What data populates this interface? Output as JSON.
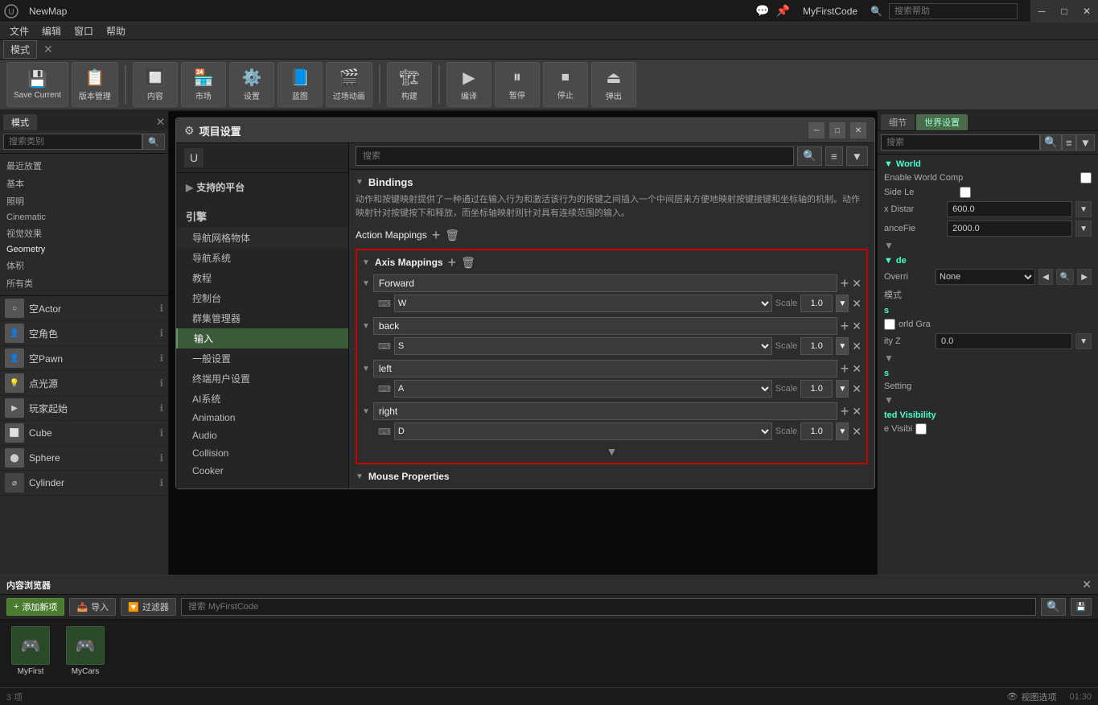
{
  "titleBar": {
    "title": "NewMap",
    "appName": "MyFirstCode",
    "minimizeLabel": "─",
    "maximizeLabel": "□",
    "closeLabel": "✕"
  },
  "menuBar": {
    "items": [
      "文件",
      "编辑",
      "窗口",
      "帮助"
    ]
  },
  "modeBar": {
    "label": "模式",
    "searchPlaceholder": "搜索类别"
  },
  "toolbar": {
    "buttons": [
      {
        "id": "save",
        "label": "Save Current",
        "icon": "💾"
      },
      {
        "id": "version",
        "label": "版本管理",
        "icon": "📋"
      },
      {
        "id": "content",
        "label": "内容",
        "icon": "🔲"
      },
      {
        "id": "market",
        "label": "市场",
        "icon": "🏪"
      },
      {
        "id": "settings",
        "label": "设置",
        "icon": "⚙️"
      },
      {
        "id": "blueprint",
        "label": "蓝图",
        "icon": "🎬"
      },
      {
        "id": "cinematic",
        "label": "过场动画",
        "icon": "🎥"
      },
      {
        "id": "build",
        "label": "构建",
        "icon": "🔨"
      },
      {
        "id": "play",
        "label": "编译",
        "icon": "▶"
      },
      {
        "id": "pause",
        "label": "暂停",
        "icon": "⏸"
      },
      {
        "id": "stop",
        "label": "停止",
        "icon": "⏹"
      },
      {
        "id": "eject",
        "label": "弹出",
        "icon": "⏏"
      }
    ]
  },
  "leftPanel": {
    "searchPlaceholder": "搜索类别",
    "categories": [
      {
        "label": "最近放置",
        "active": false
      },
      {
        "label": "基本",
        "active": false
      },
      {
        "label": "照明",
        "active": false
      },
      {
        "label": "Cinematic",
        "active": false
      },
      {
        "label": "视觉效果",
        "active": false
      },
      {
        "label": "Geometry",
        "active": true
      },
      {
        "label": "体积",
        "active": false
      },
      {
        "label": "所有类",
        "active": false
      }
    ],
    "actors": [
      {
        "label": "空Actor",
        "icon": "○"
      },
      {
        "label": "空角色",
        "icon": "👤"
      },
      {
        "label": "空Pawn",
        "icon": "👤"
      },
      {
        "label": "点光源",
        "icon": "💡"
      },
      {
        "label": "玩家起始",
        "icon": "▶"
      },
      {
        "label": "Cube",
        "icon": "⬜"
      },
      {
        "label": "Sphere",
        "icon": "⬤"
      },
      {
        "label": "Cylinder",
        "icon": "⌀"
      }
    ]
  },
  "viewport": {
    "background": "#0a0a0a"
  },
  "rightPanel": {
    "detailLabel": "细节",
    "worldSettingsLabel": "世界设置",
    "searchPlaceholder": "搜索",
    "sections": {
      "world": {
        "title": "World",
        "enableWorldComposition": {
          "label": "Enable World Comp",
          "checked": false
        },
        "sideLengthLabel": "Side Le",
        "sideLength": "",
        "xDistanceLabel": "x Distar",
        "xDistance": "600.0",
        "lancefieldLabel": "anceFie",
        "lancefield": "2000.0"
      },
      "lod": {
        "title": "de",
        "overrideLabel": "Overri",
        "overrideValue": "None",
        "modeLabel": "模式"
      },
      "gravity": {
        "title": "s",
        "worldGravityLabel": "orld Gra",
        "gravityZLabel": "ity Z",
        "gravityZ": "0.0"
      },
      "settings": {
        "title": "s",
        "settingLabel": "Setting"
      },
      "visibility": {
        "title": "ted Visibility",
        "visibleLabel": "e Visibi"
      }
    }
  },
  "dialog": {
    "title": "项目设置",
    "platformsLabel": "支持的平台",
    "engineLabel": "引擎",
    "sidebarItems": [
      {
        "label": "导航网格物体",
        "active": false
      },
      {
        "label": "导航系统",
        "active": false
      },
      {
        "label": "教程",
        "active": false
      },
      {
        "label": "控制台",
        "active": false
      },
      {
        "label": "群集管理器",
        "active": false
      },
      {
        "label": "输入",
        "active": true
      },
      {
        "label": "一般设置",
        "active": false
      },
      {
        "label": "终端用户设置",
        "active": false
      },
      {
        "label": "AI系统",
        "active": false
      },
      {
        "label": "Animation",
        "active": false
      },
      {
        "label": "Audio",
        "active": false
      },
      {
        "label": "Collision",
        "active": false
      },
      {
        "label": "Cooker",
        "active": false
      }
    ],
    "searchPlaceholder": "搜索",
    "contentHeader": "",
    "bindingsSection": {
      "title": "Bindings",
      "description": "动作和按键映射提供了一种通过在输入行为和激活该行为的按键之间插入一个中间层来方便地映射按键接键和坐标轴的机制。动作映射针对按键按下和释放，而坐标轴映射则针对具有连续范围的输入。",
      "actionMappingsLabel": "Action Mappings",
      "axisMappingsLabel": "Axis Mappings"
    },
    "axisMappings": [
      {
        "name": "Forward",
        "keys": [
          {
            "key": "W",
            "scale": "1.0"
          }
        ]
      },
      {
        "name": "back",
        "keys": [
          {
            "key": "S",
            "scale": "1.0"
          }
        ]
      },
      {
        "name": "left",
        "keys": [
          {
            "key": "A",
            "scale": "1.0"
          }
        ]
      },
      {
        "name": "right",
        "keys": [
          {
            "key": "D",
            "scale": "1.0"
          }
        ]
      }
    ],
    "mousePropertiesLabel": "Mouse Properties"
  },
  "contentBrowser": {
    "title": "内容浏览器",
    "addLabel": "添加新项",
    "importLabel": "导入",
    "searchPlaceholder": "搜索 MyFirstCode",
    "filterLabel": "过滤器",
    "countLabel": "3 项",
    "items": [
      {
        "label": "MyFirst",
        "icon": "🎮"
      },
      {
        "label": "MyCars",
        "icon": "🎮"
      }
    ]
  },
  "statusBar": {
    "countLabel": "3 项",
    "viewLabel": "视图选项",
    "timeLabel": "01:30"
  }
}
